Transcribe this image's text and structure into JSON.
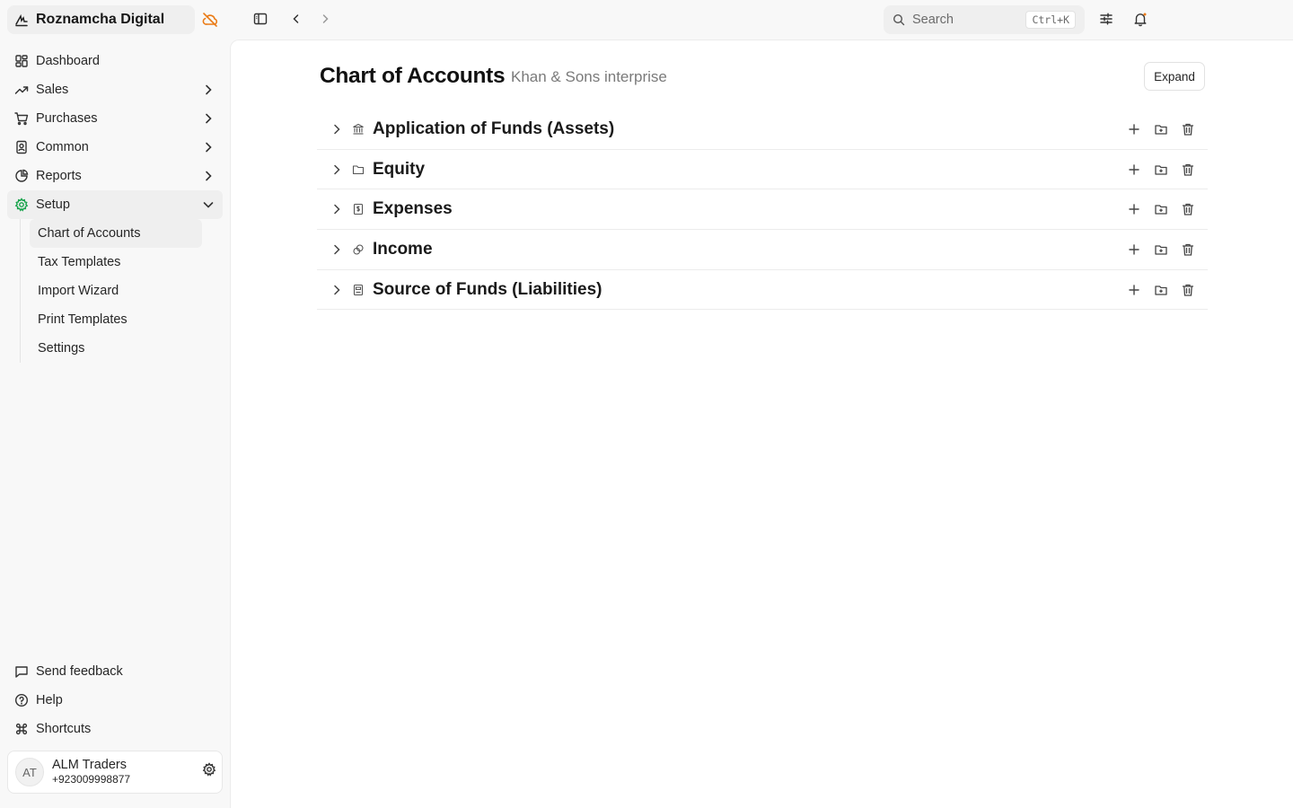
{
  "app": {
    "name": "Roznamcha Digital"
  },
  "nav": {
    "items": [
      {
        "label": "Dashboard"
      },
      {
        "label": "Sales"
      },
      {
        "label": "Purchases"
      },
      {
        "label": "Common"
      },
      {
        "label": "Reports"
      },
      {
        "label": "Setup"
      }
    ],
    "setup_sub": [
      {
        "label": "Chart of Accounts"
      },
      {
        "label": "Tax Templates"
      },
      {
        "label": "Import Wizard"
      },
      {
        "label": "Print Templates"
      },
      {
        "label": "Settings"
      }
    ],
    "bottom": [
      {
        "label": "Send feedback"
      },
      {
        "label": "Help"
      },
      {
        "label": "Shortcuts"
      }
    ]
  },
  "user": {
    "initials": "AT",
    "name": "ALM Traders",
    "phone": "+923009998877"
  },
  "search": {
    "placeholder": "Search",
    "shortcut": "Ctrl+K"
  },
  "page": {
    "title": "Chart of Accounts",
    "company": "Khan & Sons interprise",
    "expand_label": "Expand"
  },
  "accounts": [
    {
      "name": "Application of Funds (Assets)",
      "icon": "bank-icon"
    },
    {
      "name": "Equity",
      "icon": "folder-icon"
    },
    {
      "name": "Expenses",
      "icon": "receipt-icon"
    },
    {
      "name": "Income",
      "icon": "coins-icon"
    },
    {
      "name": "Source of Funds (Liabilities)",
      "icon": "ledger-icon"
    }
  ],
  "colors": {
    "accent_orange": "#ea7b16",
    "setup_green": "#16a34a"
  }
}
